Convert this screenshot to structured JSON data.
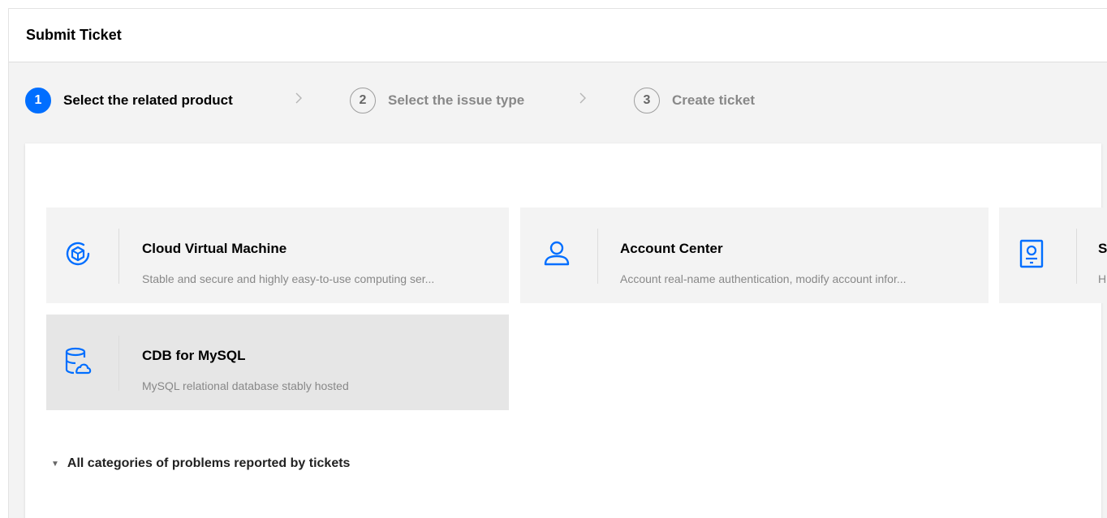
{
  "header": {
    "title": "Submit Ticket"
  },
  "steps": [
    {
      "number": "1",
      "label": "Select the related product"
    },
    {
      "number": "2",
      "label": "Select the issue type"
    },
    {
      "number": "3",
      "label": "Create ticket"
    }
  ],
  "products": [
    {
      "title": "Cloud Virtual Machine",
      "description": "Stable and secure and highly easy-to-use computing ser...",
      "icon": "cvm-cube-icon"
    },
    {
      "title": "Account Center",
      "description": "Account real-name authentication, modify account infor...",
      "icon": "user-icon"
    },
    {
      "title": "S",
      "description": "H",
      "icon": "id-card-icon"
    },
    {
      "title": "CDB for MySQL",
      "description": "MySQL relational database stably hosted",
      "icon": "database-cloud-icon"
    }
  ],
  "categories": {
    "label": "All categories of problems reported by tickets",
    "icon": "caret-down-icon"
  },
  "colors": {
    "accent": "#006eff",
    "card_bg": "#f3f3f3",
    "card_hover_bg": "#e6e6e6",
    "muted_text": "#888888"
  }
}
